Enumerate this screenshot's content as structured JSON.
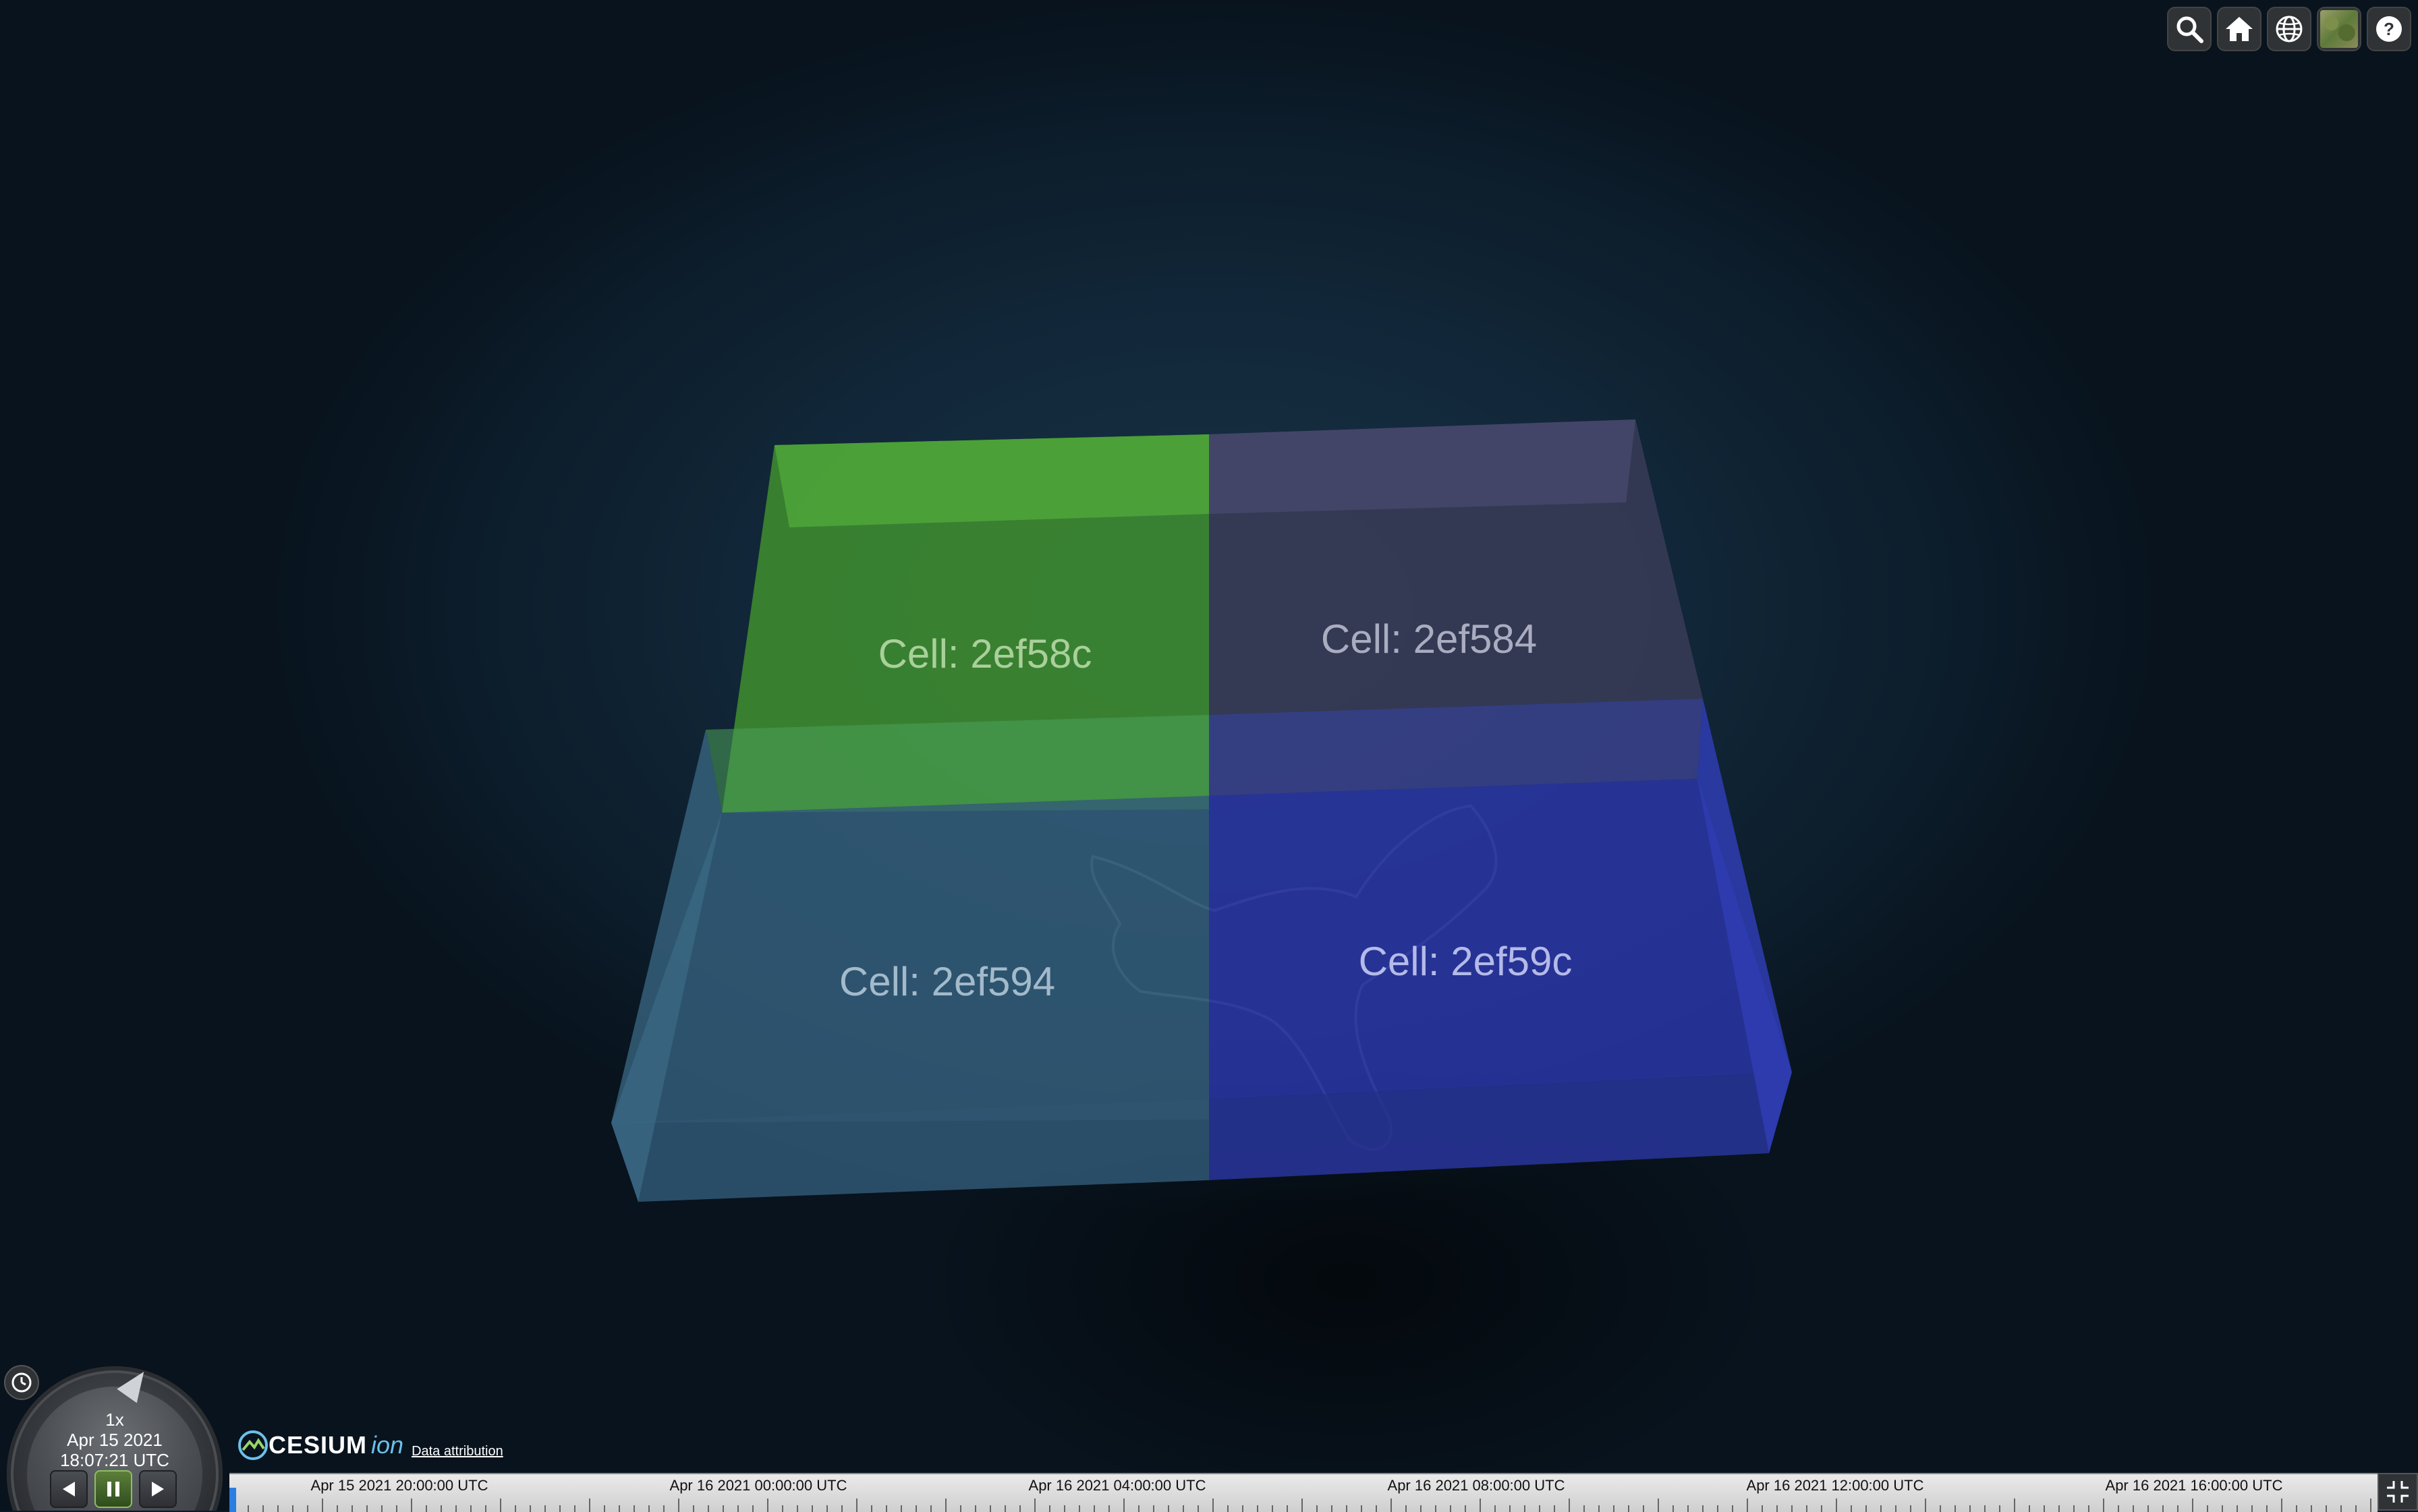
{
  "cells": [
    {
      "id": "2ef58c",
      "label": "Cell: 2ef58c",
      "color": "#3f8f2f"
    },
    {
      "id": "2ef584",
      "label": "Cell: 2ef584",
      "color": "#3b3d5c"
    },
    {
      "id": "2ef594",
      "label": "Cell: 2ef594",
      "color": "#355f7d"
    },
    {
      "id": "2ef59c",
      "label": "Cell: 2ef59c",
      "color": "#2a3aa8"
    }
  ],
  "toolbar": {
    "buttons": [
      {
        "name": "geocoder-search",
        "icon": "search-icon"
      },
      {
        "name": "home-view",
        "icon": "home-icon"
      },
      {
        "name": "scene-mode-picker",
        "icon": "globe-icon"
      },
      {
        "name": "base-layer-picker",
        "icon": "imagery-thumbnail-icon"
      },
      {
        "name": "navigation-help",
        "icon": "help-icon"
      }
    ]
  },
  "animation": {
    "speed": "1x",
    "date": "Apr 15 2021",
    "time": "18:07:21 UTC"
  },
  "credits": {
    "logo_main": "CESIUM",
    "logo_sub": "ion",
    "data_attribution": "Data attribution"
  },
  "timeline": {
    "ticks": [
      "Apr 15 2021 20:00:00 UTC",
      "Apr 16 2021 00:00:00 UTC",
      "Apr 16 2021 04:00:00 UTC",
      "Apr 16 2021 08:00:00 UTC",
      "Apr 16 2021 12:00:00 UTC",
      "Apr 16 2021 16:00:00 UTC"
    ]
  },
  "colors": {
    "accent_green": "#8dc060",
    "timeline_marker": "#2a7de1",
    "ion_blue": "#6cc0ea"
  }
}
